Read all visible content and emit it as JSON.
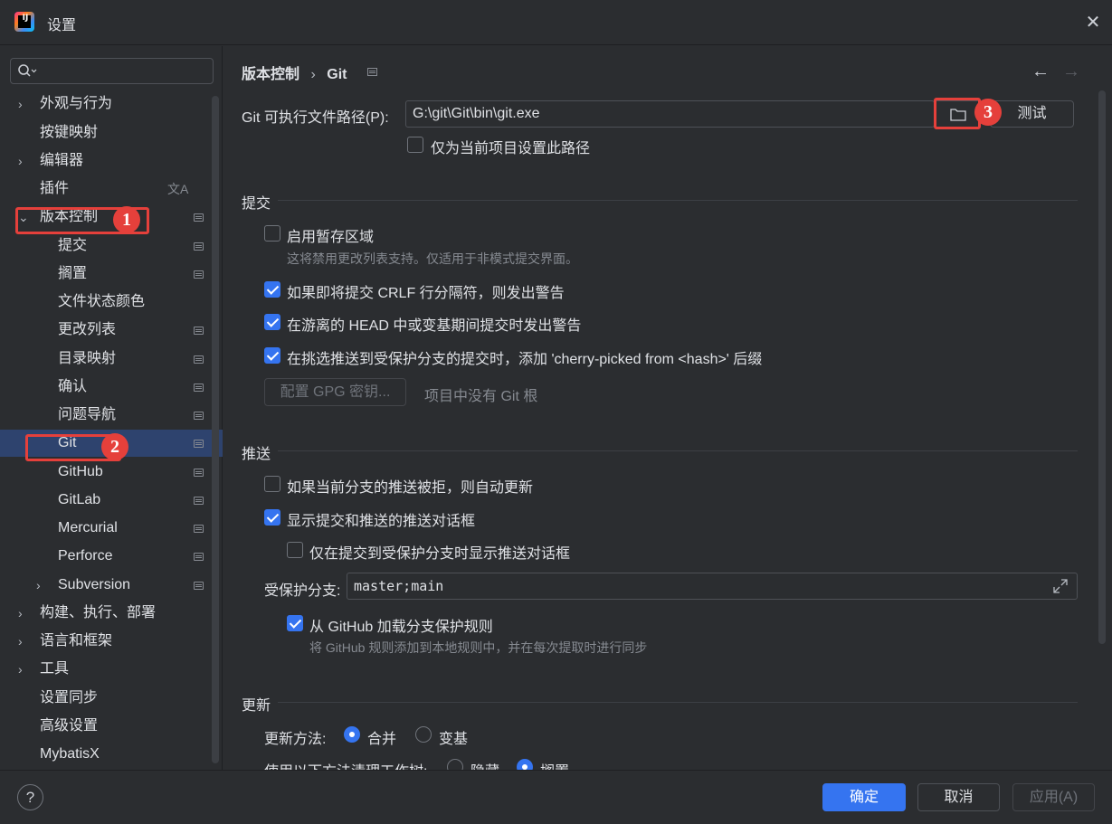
{
  "window": {
    "title": "设置",
    "logo_text": "IJ"
  },
  "sidebar": {
    "items": [
      {
        "label": "外观与行为",
        "chevron": "›"
      },
      {
        "label": "按键映射"
      },
      {
        "label": "编辑器",
        "chevron": "›"
      },
      {
        "label": "插件",
        "trailing": "文A"
      },
      {
        "label": "版本控制",
        "chevron": "⌄"
      },
      {
        "label": "提交"
      },
      {
        "label": "搁置"
      },
      {
        "label": "文件状态颜色"
      },
      {
        "label": "更改列表"
      },
      {
        "label": "目录映射"
      },
      {
        "label": "确认"
      },
      {
        "label": "问题导航"
      },
      {
        "label": "Git"
      },
      {
        "label": "GitHub"
      },
      {
        "label": "GitLab"
      },
      {
        "label": "Mercurial"
      },
      {
        "label": "Perforce"
      },
      {
        "label": "Subversion",
        "chevron": "›"
      },
      {
        "label": "构建、执行、部署",
        "chevron": "›"
      },
      {
        "label": "语言和框架",
        "chevron": "›"
      },
      {
        "label": "工具",
        "chevron": "›"
      },
      {
        "label": "设置同步"
      },
      {
        "label": "高级设置"
      },
      {
        "label": "MybatisX"
      }
    ]
  },
  "annotations": {
    "m1": "1",
    "m2": "2",
    "m3": "3"
  },
  "breadcrumb": {
    "parent": "版本控制",
    "sep": "›",
    "current": "Git"
  },
  "nav": {
    "back": "←",
    "forward": "→"
  },
  "git_path": {
    "label": "Git 可执行文件路径(P):",
    "value": "G:\\git\\Git\\bin\\git.exe",
    "test_button": "测试",
    "project_only": "仅为当前项目设置此路径"
  },
  "commit": {
    "title": "提交",
    "staging": "启用暂存区域",
    "staging_hint": "这将禁用更改列表支持。仅适用于非模式提交界面。",
    "crlf": "如果即将提交 CRLF 行分隔符，则发出警告",
    "detached": "在游离的 HEAD 中或变基期间提交时发出警告",
    "cherry": "在挑选推送到受保护分支的提交时，添加 'cherry-picked from <hash>' 后缀",
    "gpg_button": "配置 GPG 密钥...",
    "gpg_hint": "项目中没有 Git 根"
  },
  "push": {
    "title": "推送",
    "auto_update": "如果当前分支的推送被拒，则自动更新",
    "show_dialog": "显示提交和推送的推送对话框",
    "protected_only": "仅在提交到受保护分支时显示推送对话框",
    "protected_label": "受保护分支:",
    "protected_value": "master;main",
    "github_rules": "从 GitHub 加载分支保护规则",
    "github_hint": "将 GitHub 规则添加到本地规则中，并在每次提取时进行同步"
  },
  "update": {
    "title": "更新",
    "method_label": "更新方法:",
    "merge": "合并",
    "rebase": "变基",
    "clean_label": "使用以下方法清理工作树:",
    "stash": "隐藏",
    "shelve": "搁置"
  },
  "footer": {
    "help": "?",
    "ok": "确定",
    "cancel": "取消",
    "apply": "应用(A)"
  },
  "colors": {
    "accent": "#3574f0",
    "selection": "#2e436e",
    "marker": "#e5403b"
  }
}
